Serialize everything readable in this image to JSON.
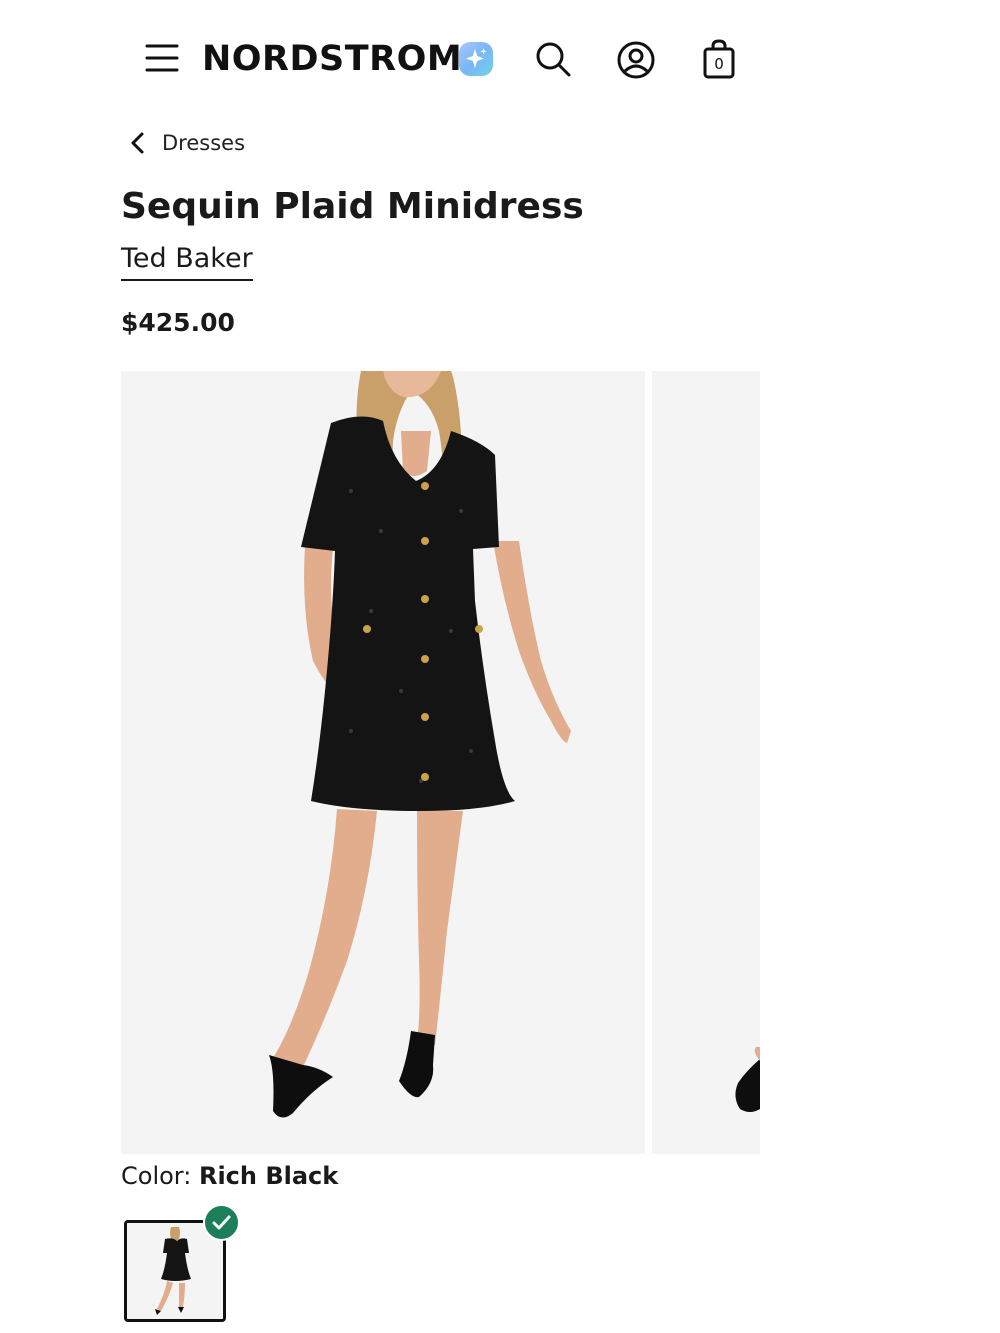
{
  "header": {
    "logo": "NORDSTROM",
    "menu_icon": "hamburger-menu-icon",
    "ai_icon": "sparkle-icon",
    "search_icon": "search-icon",
    "account_icon": "account-icon",
    "bag_icon": "shopping-bag-icon",
    "bag_count": "0"
  },
  "breadcrumb": {
    "label": "Dresses"
  },
  "product": {
    "title": "Sequin Plaid Minidress",
    "brand": "Ted Baker",
    "price": "$425.00"
  },
  "color": {
    "label": "Color:",
    "value": "Rich Black",
    "selected_swatch": "Rich Black"
  },
  "colors": {
    "accent_check": "#1d7f5a",
    "text": "#1a1a1a",
    "photo_bg": "#f4f4f4"
  }
}
